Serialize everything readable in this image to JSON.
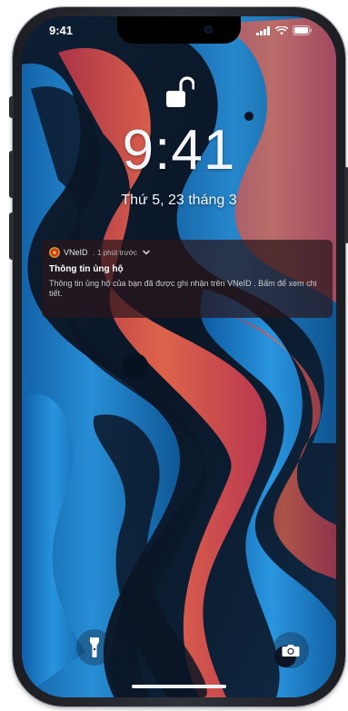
{
  "status_bar": {
    "time": "9:41",
    "icons": [
      "signal-icon",
      "wifi-icon",
      "battery-icon"
    ]
  },
  "lock_screen": {
    "lock_state": "unlocked",
    "time": "9:41",
    "date": "Thứ 5,  23 tháng 3"
  },
  "notification": {
    "app_name": "VNeID",
    "time_ago": ". 1 phút trước",
    "title": "Thông tin ủng hộ",
    "body": "Thông tin ủng hộ của bạn đã được ghi nhận trên VNeID . Bấm để xem chi tiết."
  },
  "quick_actions": {
    "flashlight": "flashlight-icon",
    "camera": "camera-icon"
  },
  "colors": {
    "notification_bg": "#2a161c",
    "wallpaper_blue": "#1b7fd0",
    "wallpaper_coral": "#e2584c",
    "wallpaper_dark": "#0b1a2b"
  }
}
